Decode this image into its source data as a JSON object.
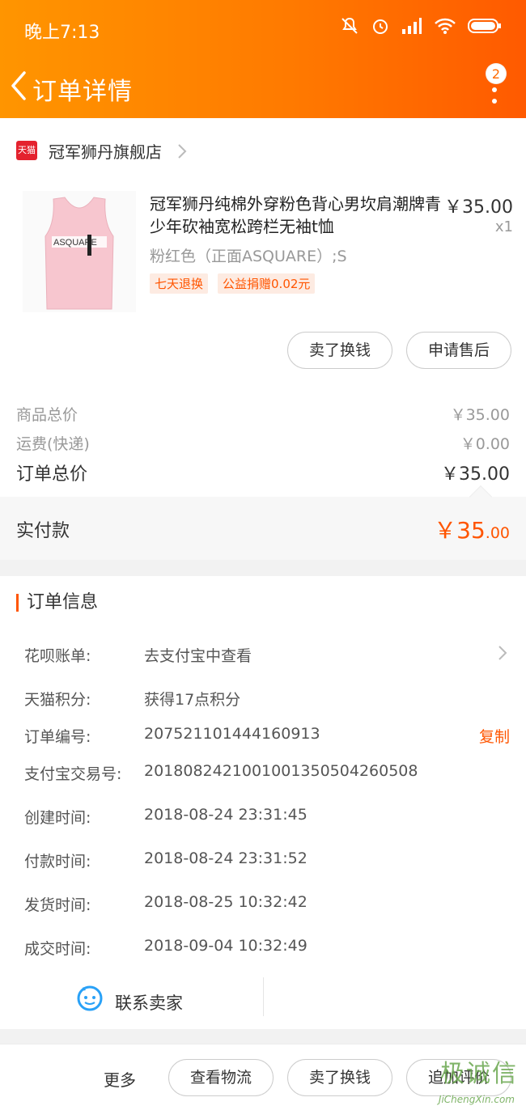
{
  "status_bar": {
    "time": "晚上7:13"
  },
  "nav": {
    "title": "订单详情",
    "badge_count": "2"
  },
  "shop": {
    "logo_text": "天猫",
    "name": "冠军狮丹旗舰店"
  },
  "product": {
    "title": "冠军狮丹纯棉外穿粉色背心男坎肩潮牌青少年砍袖宽松跨栏无袖t恤",
    "price": "￥35.00",
    "qty": "x1",
    "spec": "粉红色（正面ASQUARE）;S",
    "image_text": "ASQUARE",
    "tags": [
      "七天退换",
      "公益捐赠0.02元"
    ]
  },
  "item_actions": {
    "sell": "卖了换钱",
    "after_sale": "申请售后"
  },
  "pricing": {
    "goods_label": "商品总价",
    "goods_value": "￥35.00",
    "shipping_label": "运费(快递)",
    "shipping_value": "￥0.00",
    "total_label": "订单总价",
    "total_value": "￥35.00",
    "paid_label": "实付款",
    "paid_value_main": "￥35",
    "paid_value_decimal": ".00"
  },
  "order_info": {
    "title": "订单信息",
    "huabei": {
      "label": "花呗账单:",
      "value": "去支付宝中查看"
    },
    "points": {
      "label": "天猫积分:",
      "value": "获得17点积分"
    },
    "order_no": {
      "label": "订单编号:",
      "value": "207521101444160913",
      "action": "复制"
    },
    "alipay_no": {
      "label": "支付宝交易号:",
      "value": "2018082421001001350504260508"
    },
    "created": {
      "label": "创建时间:",
      "value": "2018-08-24 23:31:45"
    },
    "paid": {
      "label": "付款时间:",
      "value": "2018-08-24 23:31:52"
    },
    "shipped": {
      "label": "发货时间:",
      "value": "2018-08-25 10:32:42"
    },
    "completed": {
      "label": "成交时间:",
      "value": "2018-09-04 10:32:49"
    }
  },
  "contact": {
    "label": "联系卖家"
  },
  "bottom": {
    "more": "更多",
    "logistics": "查看物流",
    "sell": "卖了换钱",
    "review": "追加评价"
  },
  "watermark": {
    "main": "极诚信",
    "sub": "JiChengXin.com"
  },
  "colors": {
    "accent": "#ff5500",
    "header_start": "#ff9500",
    "header_end": "#ff5a00",
    "tmall": "#e4222e"
  }
}
